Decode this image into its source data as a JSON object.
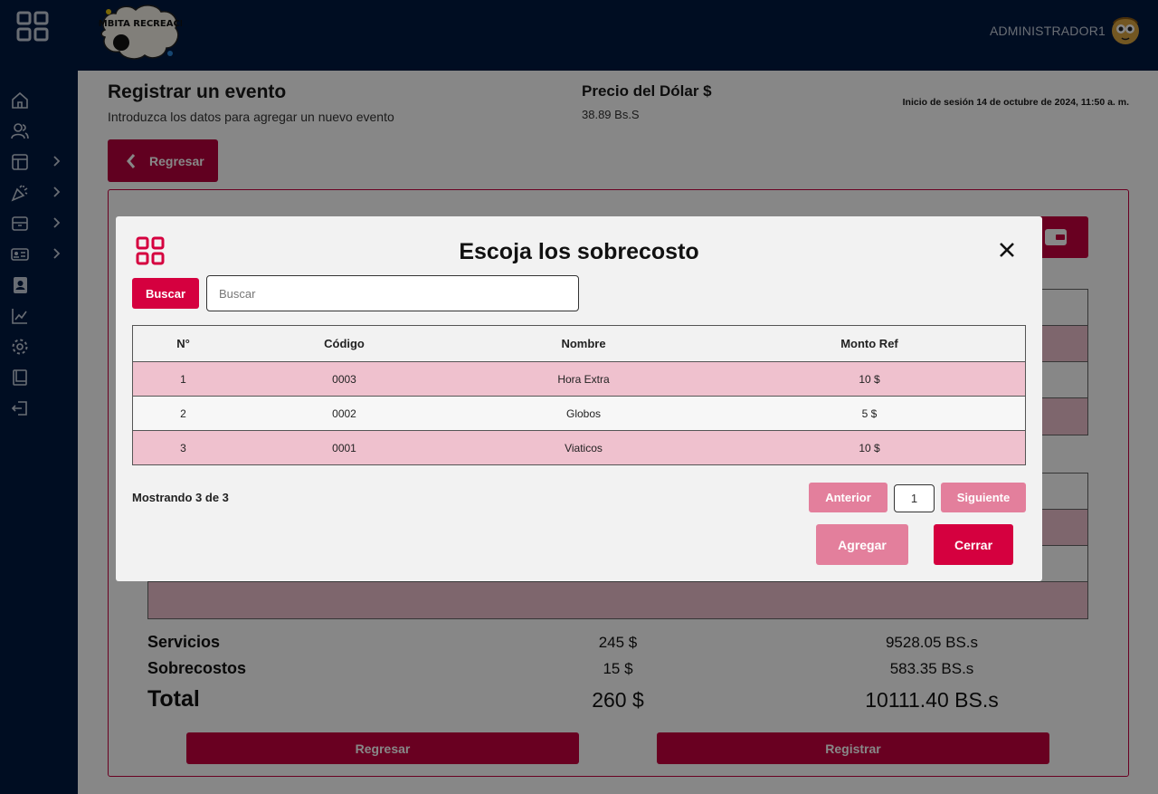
{
  "header": {
    "user_name": "ADMINISTRADOR1",
    "brand_logo_text": "BOMBITA RECREACIÓN"
  },
  "sidebar": {
    "items": [
      {
        "name": "home",
        "icon": "home-icon",
        "expandable": false
      },
      {
        "name": "users",
        "icon": "users-icon",
        "expandable": false
      },
      {
        "name": "layout",
        "icon": "layout-icon",
        "expandable": true
      },
      {
        "name": "party",
        "icon": "party-icon",
        "expandable": true
      },
      {
        "name": "inventory",
        "icon": "archive-icon",
        "expandable": true
      },
      {
        "name": "cards",
        "icon": "id-card-icon",
        "expandable": true
      },
      {
        "name": "contacts",
        "icon": "contact-book-icon",
        "expandable": false
      },
      {
        "name": "reports",
        "icon": "chart-line-icon",
        "expandable": false
      },
      {
        "name": "settings",
        "icon": "gear-icon",
        "expandable": false
      },
      {
        "name": "manual",
        "icon": "book-icon",
        "expandable": false
      },
      {
        "name": "logout",
        "icon": "logout-icon",
        "expandable": false
      }
    ]
  },
  "page": {
    "title": "Registrar un evento",
    "subtitle": "Introduzca los datos para agregar un nuevo evento",
    "dollar_title": "Precio del Dólar $",
    "dollar_value": "38.89 Bs.S",
    "session": "Inicio de sesión 14 de octubre de 2024, 11:50 a. m.",
    "back_label": "Regresar"
  },
  "totals": {
    "services_label": "Servicios",
    "services_usd": "245 $",
    "services_bs": "9528.05 BS.s",
    "overcosts_label": "Sobrecostos",
    "overcosts_usd": "15 $",
    "overcosts_bs": "583.35 BS.s",
    "total_label": "Total",
    "total_usd": "260 $",
    "total_bs": "10111.40 BS.s"
  },
  "footer": {
    "back_label": "Regresar",
    "register_label": "Registrar"
  },
  "modal": {
    "title": "Escoja los sobrecosto",
    "search_button": "Buscar",
    "search_placeholder": "Buscar",
    "columns": [
      "N°",
      "Código",
      "Nombre",
      "Monto Ref"
    ],
    "rows": [
      [
        "1",
        "0003",
        "Hora Extra",
        "10 $"
      ],
      [
        "2",
        "0002",
        "Globos",
        "5 $"
      ],
      [
        "3",
        "0001",
        "Viaticos",
        "10 $"
      ]
    ],
    "showing": "Mostrando 3 de 3",
    "prev_label": "Anterior",
    "page_value": "1",
    "next_label": "Siguiente",
    "add_label": "Agregar",
    "close_label": "Cerrar"
  },
  "colors": {
    "navy": "#001a41",
    "accent": "#c7003f",
    "accent_light": "#e37f9c",
    "row_pink": "#efc1ce"
  }
}
